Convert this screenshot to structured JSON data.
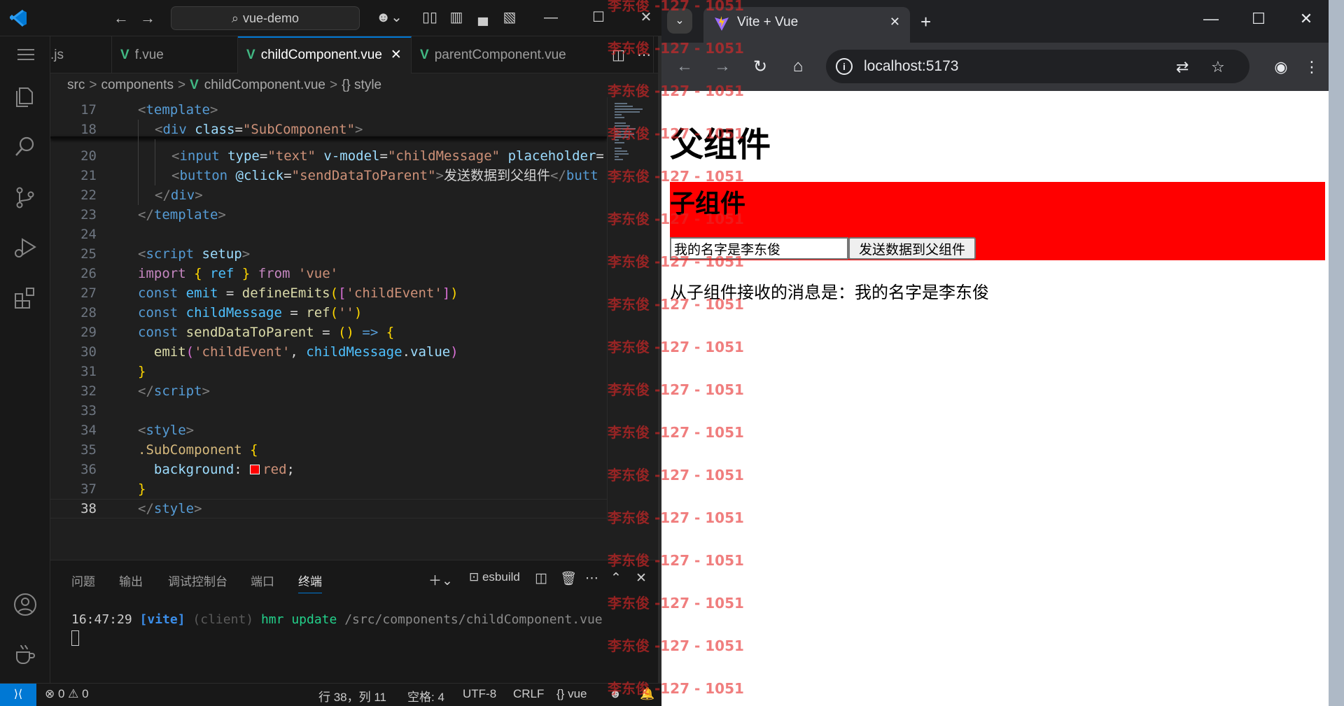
{
  "vscode": {
    "search": "vue-demo",
    "tabs": [
      {
        "label": ".js",
        "active": false
      },
      {
        "label": "f.vue",
        "active": false
      },
      {
        "label": "childComponent.vue",
        "active": true
      },
      {
        "label": "parentComponent.vue",
        "active": false
      }
    ],
    "breadcrumb": [
      "src",
      "components",
      "childComponent.vue",
      "{} style"
    ],
    "code_lines": [
      {
        "n": "17",
        "html": "<span class='t-punc'>&lt;</span><span class='t-tag'>template</span><span class='t-punc'>&gt;</span>",
        "indent": 0
      },
      {
        "n": "18",
        "html": "<span class='t-punc'>&lt;</span><span class='t-tag'>div</span> <span class='t-attr'>class</span><span class='t-text'>=</span><span class='t-str'>\"SubComponent\"</span><span class='t-punc'>&gt;</span>",
        "indent": 1
      },
      {
        "n": "20",
        "html": "<span class='t-punc'>&lt;</span><span class='t-tag'>input</span> <span class='t-attr'>type</span><span class='t-text'>=</span><span class='t-str'>\"text\"</span> <span class='t-attr'>v-model</span><span class='t-text'>=</span><span class='t-str'>\"childMessage\"</span> <span class='t-attr'>placeholder</span><span class='t-text'>=</span>",
        "indent": 2
      },
      {
        "n": "21",
        "html": "<span class='t-punc'>&lt;</span><span class='t-tag'>button</span> <span class='t-attr'>@click</span><span class='t-text'>=</span><span class='t-str'>\"sendDataToParent\"</span><span class='t-punc'>&gt;</span><span class='t-text'>发送数据到父组件</span><span class='t-punc'>&lt;/</span><span class='t-tag'>butt</span>",
        "indent": 2
      },
      {
        "n": "22",
        "html": "<span class='t-punc'>&lt;/</span><span class='t-tag'>div</span><span class='t-punc'>&gt;</span>",
        "indent": 1
      },
      {
        "n": "23",
        "html": "<span class='t-punc'>&lt;/</span><span class='t-tag'>template</span><span class='t-punc'>&gt;</span>",
        "indent": 0
      },
      {
        "n": "24",
        "html": "",
        "indent": 0
      },
      {
        "n": "25",
        "html": "<span class='t-punc'>&lt;</span><span class='t-tag'>script</span> <span class='t-attr'>setup</span><span class='t-punc'>&gt;</span>",
        "indent": 0
      },
      {
        "n": "26",
        "html": "<span class='t-kw'>import</span> <span class='t-brace'>{</span> <span class='t-var'>ref</span> <span class='t-brace'>}</span> <span class='t-kw'>from</span> <span class='t-str'>'vue'</span>",
        "indent": 0
      },
      {
        "n": "27",
        "html": "<span class='t-decl'>const</span> <span class='t-var'>emit</span> <span class='t-text'>=</span> <span class='t-func'>defineEmits</span><span class='t-brace'>(</span><span class='t-brace2'>[</span><span class='t-str'>'childEvent'</span><span class='t-brace2'>]</span><span class='t-brace'>)</span>",
        "indent": 0
      },
      {
        "n": "28",
        "html": "<span class='t-decl'>const</span> <span class='t-var'>childMessage</span> <span class='t-text'>=</span> <span class='t-func'>ref</span><span class='t-brace'>(</span><span class='t-str'>''</span><span class='t-brace'>)</span>",
        "indent": 0
      },
      {
        "n": "29",
        "html": "<span class='t-decl'>const</span> <span class='t-func'>sendDataToParent</span> <span class='t-text'>=</span> <span class='t-brace'>()</span> <span class='t-decl'>=&gt;</span> <span class='t-brace'>{</span>",
        "indent": 0
      },
      {
        "n": "30",
        "html": "  <span class='t-func'>emit</span><span class='t-brace2'>(</span><span class='t-str'>'childEvent'</span><span class='t-text'>,</span> <span class='t-var'>childMessage</span><span class='t-text'>.</span><span class='t-prop'>value</span><span class='t-brace2'>)</span>",
        "indent": 0
      },
      {
        "n": "31",
        "html": "<span class='t-brace'>}</span>",
        "indent": 0
      },
      {
        "n": "32",
        "html": "<span class='t-punc'>&lt;/</span><span class='t-tag'>script</span><span class='t-punc'>&gt;</span>",
        "indent": 0
      },
      {
        "n": "33",
        "html": "",
        "indent": 0
      },
      {
        "n": "34",
        "html": "<span class='t-punc'>&lt;</span><span class='t-tag'>style</span><span class='t-punc'>&gt;</span>",
        "indent": 0
      },
      {
        "n": "35",
        "html": "<span class='t-sel'>.SubComponent</span> <span class='t-brace'>{</span>",
        "indent": 0
      },
      {
        "n": "36",
        "html": "  <span class='t-prop'>background</span><span class='t-text'>:</span> <span class='swatch'></span><span class='t-str'>red</span><span class='t-text'>;</span>",
        "indent": 0
      },
      {
        "n": "37",
        "html": "<span class='t-brace'>}</span>",
        "indent": 0
      },
      {
        "n": "38",
        "html": "<span class='t-punc'>&lt;/</span><span class='t-tag'>style</span><span class='t-punc'>&gt;</span>",
        "indent": 0,
        "current": true
      }
    ],
    "panel_tabs": [
      "问题",
      "输出",
      "调试控制台",
      "端口",
      "终端"
    ],
    "panel_active": "终端",
    "terminal_name": "esbuild",
    "terminal": {
      "time": "16:47:29",
      "tag": "[vite]",
      "client": "(client)",
      "hmr": "hmr update",
      "path": "/src/components/childComponent.vue"
    },
    "status": {
      "errors": "0",
      "warnings": "0",
      "position": "行 38，列 11",
      "spaces": "空格: 4",
      "encoding": "UTF-8",
      "eol": "CRLF",
      "language": "vue"
    }
  },
  "browser": {
    "tab_title": "Vite + Vue",
    "url": "localhost:5173",
    "page": {
      "parent_heading": "父组件",
      "child_heading": "子组件",
      "input_value": "我的名字是李东俊",
      "button_label": "发送数据到父组件",
      "received_label": "从子组件接收的消息是：",
      "received_message": "我的名字是李东俊"
    }
  },
  "watermark": "李东俊 -127 - 1051",
  "colors": {
    "accent": "#0078d4",
    "subcomponent_bg": "#ff0000",
    "vue_green": "#41b883"
  }
}
